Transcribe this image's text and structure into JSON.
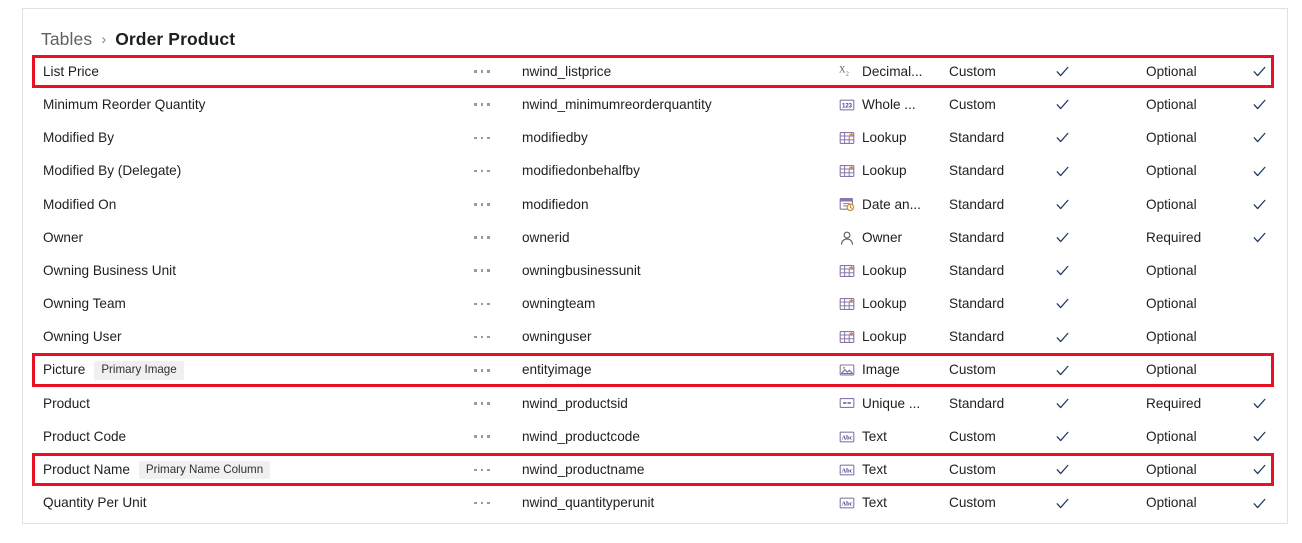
{
  "breadcrumb": {
    "parent": "Tables",
    "separator": "›",
    "current": "Order Product"
  },
  "grid": {
    "ellipsis_label": "More commands",
    "rows": [
      {
        "display_name": "List Price",
        "badge": "",
        "logical_name": "nwind_listprice",
        "data_type": "Decimal...",
        "data_type_icon": "decimal-number-icon",
        "type_of": "Custom",
        "customizable": true,
        "required_level": "Optional",
        "searchable": true,
        "highlighted": true
      },
      {
        "display_name": "Minimum Reorder Quantity",
        "badge": "",
        "logical_name": "nwind_minimumreorderquantity",
        "data_type": "Whole ...",
        "data_type_icon": "whole-number-icon",
        "type_of": "Custom",
        "customizable": true,
        "required_level": "Optional",
        "searchable": true,
        "highlighted": false
      },
      {
        "display_name": "Modified By",
        "badge": "",
        "logical_name": "modifiedby",
        "data_type": "Lookup",
        "data_type_icon": "lookup-icon",
        "type_of": "Standard",
        "customizable": true,
        "required_level": "Optional",
        "searchable": true,
        "highlighted": false
      },
      {
        "display_name": "Modified By (Delegate)",
        "badge": "",
        "logical_name": "modifiedonbehalfby",
        "data_type": "Lookup",
        "data_type_icon": "lookup-icon",
        "type_of": "Standard",
        "customizable": true,
        "required_level": "Optional",
        "searchable": true,
        "highlighted": false
      },
      {
        "display_name": "Modified On",
        "badge": "",
        "logical_name": "modifiedon",
        "data_type": "Date an...",
        "data_type_icon": "date-and-time-icon",
        "type_of": "Standard",
        "customizable": true,
        "required_level": "Optional",
        "searchable": true,
        "highlighted": false
      },
      {
        "display_name": "Owner",
        "badge": "",
        "logical_name": "ownerid",
        "data_type": "Owner",
        "data_type_icon": "owner-person-icon",
        "type_of": "Standard",
        "customizable": true,
        "required_level": "Required",
        "searchable": true,
        "highlighted": false
      },
      {
        "display_name": "Owning Business Unit",
        "badge": "",
        "logical_name": "owningbusinessunit",
        "data_type": "Lookup",
        "data_type_icon": "lookup-icon",
        "type_of": "Standard",
        "customizable": true,
        "required_level": "Optional",
        "searchable": false,
        "highlighted": false
      },
      {
        "display_name": "Owning Team",
        "badge": "",
        "logical_name": "owningteam",
        "data_type": "Lookup",
        "data_type_icon": "lookup-icon",
        "type_of": "Standard",
        "customizable": true,
        "required_level": "Optional",
        "searchable": false,
        "highlighted": false
      },
      {
        "display_name": "Owning User",
        "badge": "",
        "logical_name": "owninguser",
        "data_type": "Lookup",
        "data_type_icon": "lookup-icon",
        "type_of": "Standard",
        "customizable": true,
        "required_level": "Optional",
        "searchable": false,
        "highlighted": false
      },
      {
        "display_name": "Picture",
        "badge": "Primary Image",
        "logical_name": "entityimage",
        "data_type": "Image",
        "data_type_icon": "image-icon",
        "type_of": "Custom",
        "customizable": true,
        "required_level": "Optional",
        "searchable": false,
        "highlighted": true
      },
      {
        "display_name": "Product",
        "badge": "",
        "logical_name": "nwind_productsid",
        "data_type": "Unique ...",
        "data_type_icon": "unique-identifier-icon",
        "type_of": "Standard",
        "customizable": true,
        "required_level": "Required",
        "searchable": true,
        "highlighted": false
      },
      {
        "display_name": "Product Code",
        "badge": "",
        "logical_name": "nwind_productcode",
        "data_type": "Text",
        "data_type_icon": "text-icon",
        "type_of": "Custom",
        "customizable": true,
        "required_level": "Optional",
        "searchable": true,
        "highlighted": false
      },
      {
        "display_name": "Product Name",
        "badge": "Primary Name Column",
        "logical_name": "nwind_productname",
        "data_type": "Text",
        "data_type_icon": "text-icon",
        "type_of": "Custom",
        "customizable": true,
        "required_level": "Optional",
        "searchable": true,
        "highlighted": true
      },
      {
        "display_name": "Quantity Per Unit",
        "badge": "",
        "logical_name": "nwind_quantityperunit",
        "data_type": "Text",
        "data_type_icon": "text-icon",
        "type_of": "Custom",
        "customizable": true,
        "required_level": "Optional",
        "searchable": true,
        "highlighted": false
      }
    ]
  },
  "colors": {
    "highlight": "#e81123",
    "checkmark": "#1f3864",
    "badge_bg": "#f0f0f0",
    "panel_border": "#e1e1e1"
  }
}
